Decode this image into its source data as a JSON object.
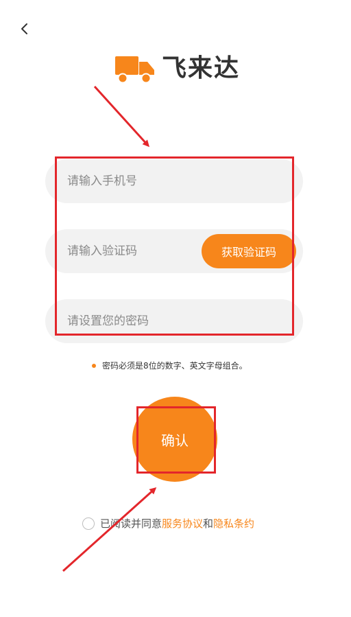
{
  "header": {
    "back_icon": "chevron-left-icon",
    "logo_icon": "truck-icon",
    "logo_text": "飞来达"
  },
  "form": {
    "phone_placeholder": "请输入手机号",
    "code_placeholder": "请输入验证码",
    "get_code_label": "获取验证码",
    "password_placeholder": "请设置您的密码"
  },
  "hint": {
    "text": "密码必须是8位的数字、英文字母组合。"
  },
  "confirm_label": "确认",
  "agreement": {
    "prefix": "已阅读并同意",
    "service_link": "服务协议",
    "conjunction": "和",
    "privacy_link": "隐私条约"
  },
  "colors": {
    "accent": "#f7861b",
    "annotation": "#e3262b",
    "field_bg": "#f2f2f2"
  }
}
